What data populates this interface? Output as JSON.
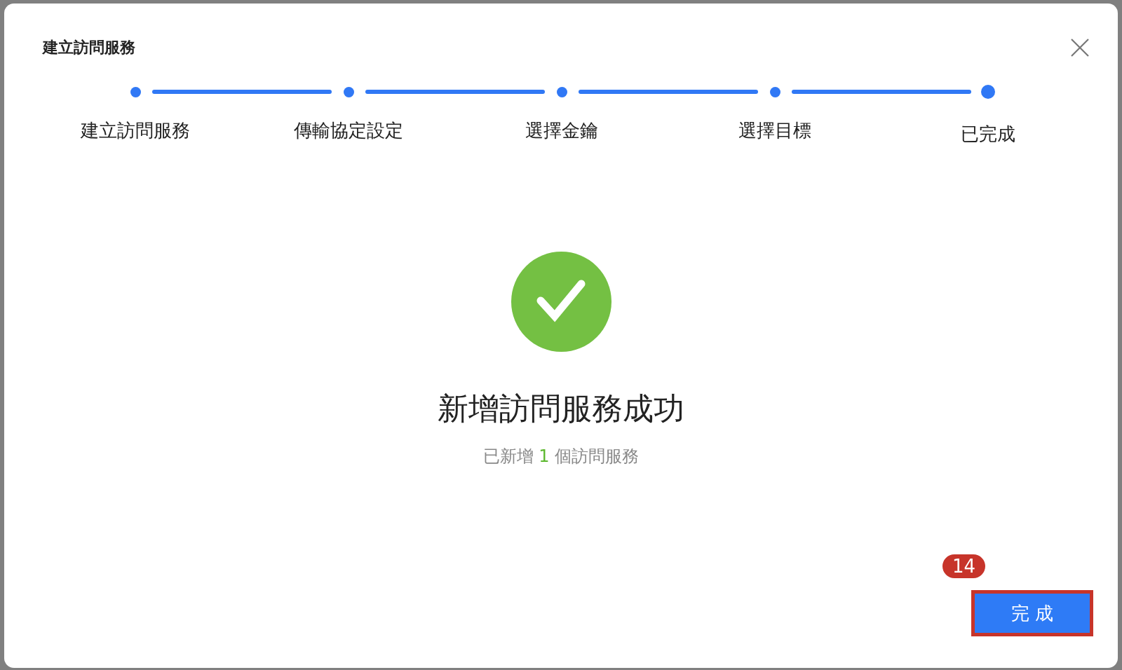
{
  "dialog": {
    "title": "建立訪問服務"
  },
  "steps": [
    {
      "label": "建立訪問服務",
      "done": true,
      "current": false
    },
    {
      "label": "傳輸協定設定",
      "done": true,
      "current": false
    },
    {
      "label": "選擇金鑰",
      "done": true,
      "current": false
    },
    {
      "label": "選擇目標",
      "done": true,
      "current": false
    },
    {
      "label": "已完成",
      "done": true,
      "current": true
    }
  ],
  "result": {
    "heading": "新增訪問服務成功",
    "message": "已新增 **1** 個訪問服務"
  },
  "footer": {
    "button": "完成",
    "highlighted": true,
    "badge": "14"
  }
}
